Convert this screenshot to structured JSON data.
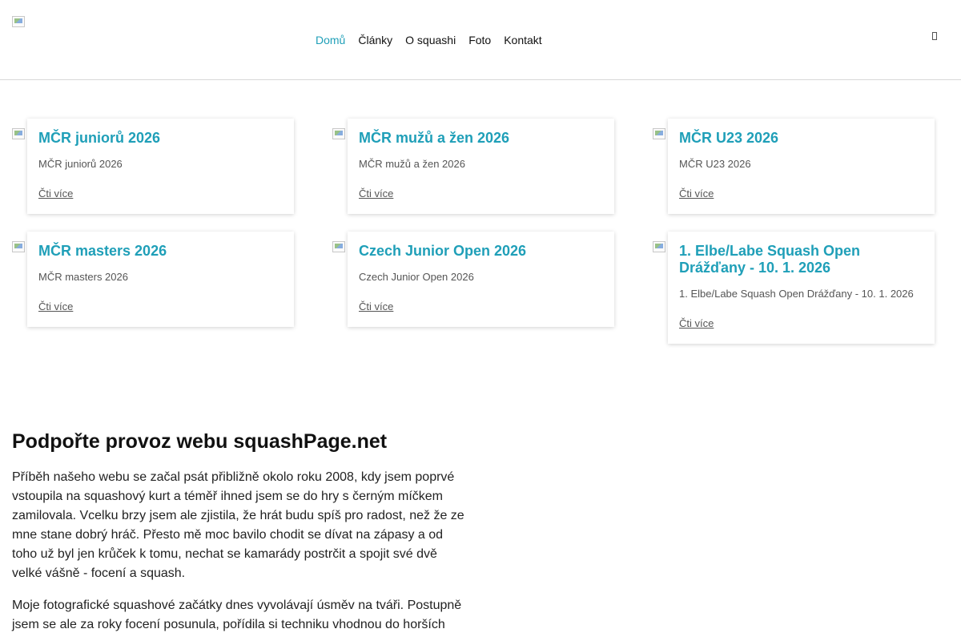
{
  "header": {
    "logo_alt": "",
    "nav": [
      {
        "label": "Domů",
        "active": true
      },
      {
        "label": "Články",
        "active": false
      },
      {
        "label": "O squashi",
        "active": false
      },
      {
        "label": "Foto",
        "active": false
      },
      {
        "label": "Kontakt",
        "active": false
      }
    ],
    "menu_icon": "menu-icon"
  },
  "articles": [
    {
      "title": "MČR juniorů 2026",
      "excerpt": "MČR juniorů 2026",
      "more": "Čti více"
    },
    {
      "title": "MČR mužů a žen 2026",
      "excerpt": "MČR mužů a žen 2026",
      "more": "Čti více"
    },
    {
      "title": "MČR U23 2026",
      "excerpt": "MČR U23 2026",
      "more": "Čti více"
    },
    {
      "title": "MČR masters 2026",
      "excerpt": "MČR masters 2026",
      "more": "Čti více"
    },
    {
      "title": "Czech Junior Open 2026",
      "excerpt": "Czech Junior Open 2026",
      "more": "Čti více"
    },
    {
      "title": "1. Elbe/Labe Squash Open Drážďany - 10. 1. 2026",
      "excerpt": "1. Elbe/Labe Squash Open Drážďany - 10. 1. 2026",
      "more": "Čti více"
    }
  ],
  "support": {
    "heading": "Podpořte provoz webu squashPage.net",
    "paragraphs": [
      "Příběh našeho webu se začal psát přibližně okolo roku 2008, kdy jsem poprvé vstoupila na squashový kurt a téměř ihned jsem se do hry s černým míčkem zamilovala. Vcelku brzy jsem ale zjistila, že hrát budu spíš pro radost, než že ze mne stane dobrý hráč. Přesto mě moc bavilo chodit se dívat na zápasy a od toho už byl jen krůček k tomu, nechat se kamarády postrčit a spojit své dvě velké vášně - focení a squash.",
      "Moje fotografické squashové začátky dnes vyvolávají úsměv na tváři. Postupně jsem se ale za roky focení posunula, pořídila si techniku vhodnou do horších"
    ]
  },
  "colors": {
    "accent": "#1f9fb8",
    "text": "#111111",
    "muted": "#555555"
  }
}
